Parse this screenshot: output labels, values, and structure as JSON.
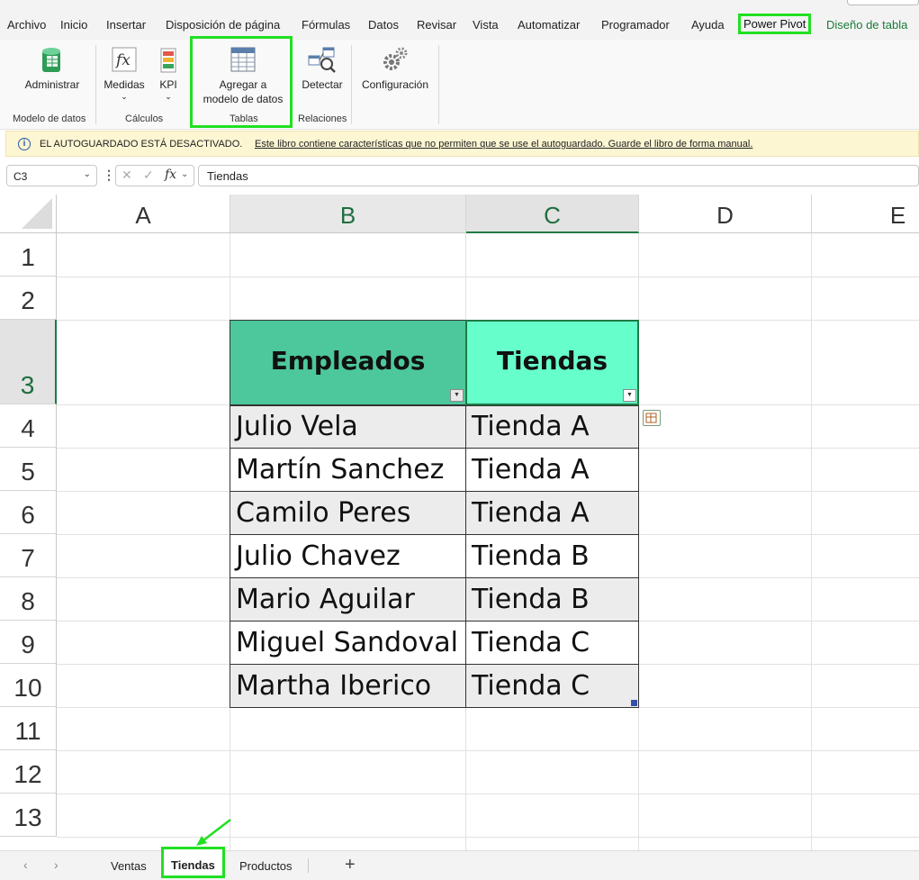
{
  "menu": {
    "tabs": [
      "Archivo",
      "Inicio",
      "Insertar",
      "Disposición de página",
      "Fórmulas",
      "Datos",
      "Revisar",
      "Vista",
      "Automatizar",
      "Programador",
      "Ayuda",
      "Power Pivot",
      "Diseño de tabla"
    ],
    "active_tab": "Power Pivot"
  },
  "ribbon": {
    "administrar": "Administrar",
    "medidas": "Medidas",
    "kpi": "KPI",
    "agregar_line1": "Agregar a",
    "agregar_line2": "modelo de datos",
    "detectar": "Detectar",
    "configuracion": "Configuración",
    "group_modelo": "Modelo de datos",
    "group_calculos": "Cálculos",
    "group_tablas": "Tablas",
    "group_relaciones": "Relaciones"
  },
  "infobar": {
    "title": "EL AUTOGUARDADO ESTÁ DESACTIVADO.",
    "message": "Este libro contiene características que no permiten que se use el autoguardado. Guarde el libro de forma manual."
  },
  "formula_bar": {
    "name_box": "C3",
    "content": "Tiendas",
    "fx": "fx"
  },
  "grid": {
    "columns": [
      "A",
      "B",
      "C",
      "D",
      "E"
    ],
    "rows": [
      "1",
      "2",
      "3",
      "4",
      "5",
      "6",
      "7",
      "8",
      "9",
      "10",
      "11",
      "12",
      "13"
    ],
    "selected_column": "C",
    "selected_row": "3"
  },
  "table": {
    "headers": [
      "Empleados",
      "Tiendas"
    ],
    "rows": [
      [
        "Julio Vela",
        "Tienda A"
      ],
      [
        "Martín Sanchez",
        "Tienda A"
      ],
      [
        "Camilo Peres",
        "Tienda A"
      ],
      [
        "Julio Chavez",
        "Tienda B"
      ],
      [
        "Mario Aguilar",
        "Tienda B"
      ],
      [
        "Miguel Sandoval",
        "Tienda C"
      ],
      [
        "Martha Iberico",
        "Tienda C"
      ]
    ],
    "colors": {
      "header_b": "#4dc89c",
      "header_c": "#66ffcc",
      "band": "#ececec",
      "plain": "#ffffff"
    }
  },
  "sheets": {
    "tabs": [
      "Ventas",
      "Tiendas",
      "Productos"
    ],
    "active": "Tiendas",
    "add_label": "+"
  },
  "accent": {
    "highlight": "#21e021",
    "excel_green": "#1f7a44"
  }
}
